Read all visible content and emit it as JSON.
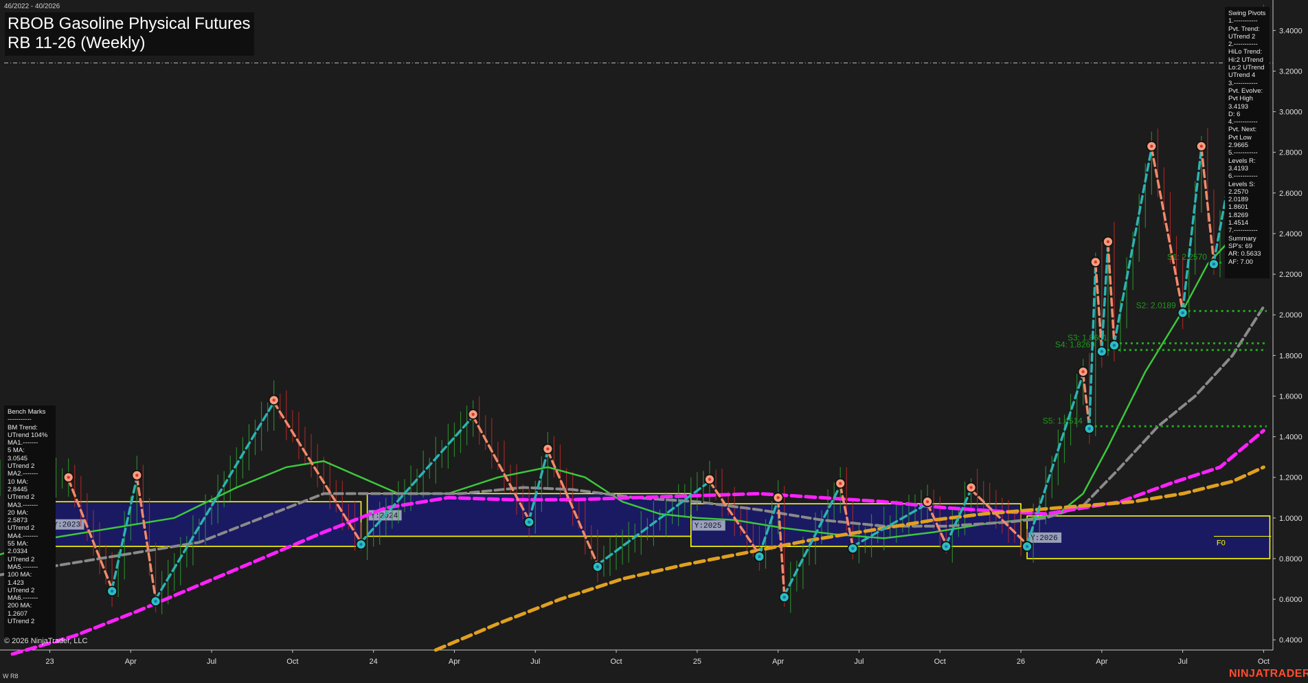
{
  "header": {
    "date_range": "46/2022 - 40/2026",
    "title_line1": "RBOB Gasoline Physical Futures",
    "title_line2": "RB 11-26 (Weekly)"
  },
  "footer": {
    "copyright": "© 2026 NinjaTrader, LLC",
    "period": "W R8",
    "brand": "NINJATRADER"
  },
  "swing_pivots_panel": [
    "Swing Pivots",
    "1.-----------",
    "Pvt. Trend:",
    "UTrend 2",
    "2.-----------",
    "HiLo Trend:",
    "Hi:2 UTrend",
    "Lo:2 UTrend",
    "UTrend 4",
    "3.-----------",
    "Pvt. Evolve:",
    "Pvt High",
    "3.4193",
    "D: 6",
    "4.-----------",
    "Pvt. Next:",
    "Pvt Low",
    "2.9665",
    "5.-----------",
    "Levels R:",
    "3.4193",
    "6.-----------",
    "Levels S:",
    "2.2570",
    "2.0189",
    "1.8601",
    "1.8269",
    "1.4514",
    "7.-----------",
    "Summary",
    "SP's: 69",
    "AR: 0.5633",
    "AF: 7.00"
  ],
  "bench_marks_panel": [
    "Bench Marks",
    "-----------",
    "BM Trend:",
    "UTrend 104%",
    "MA1.-------",
    "5 MA:",
    "3.0545",
    "UTrend 2",
    "MA2.-------",
    "10 MA:",
    "2.8445",
    "UTrend 2",
    "MA3.-------",
    "20 MA:",
    "2.5873",
    "UTrend 2",
    "MA4.-------",
    "55 MA:",
    "2.0334",
    "UTrend 2",
    "MA5.-------",
    "100 MA:",
    "1.423",
    "UTrend 2",
    "MA6.-------",
    "200 MA:",
    "1.2607",
    "UTrend 2"
  ],
  "colors": {
    "background": "#1c1c1c",
    "pivot_up_line": "#2bb3b3",
    "pivot_down_line": "#f08a6a",
    "ma_fast": "#3cc83c",
    "ma_55": "#8a8a8a",
    "ma_100": "#ff22ff",
    "ma_200": "#e0a020",
    "year_box": "#ffff00",
    "year_fill": "#1a1a6e",
    "support": "#1faa1f"
  },
  "chart_data": {
    "type": "line",
    "xlabel": "",
    "ylabel": "",
    "ylim": [
      0.35,
      3.55
    ],
    "y_ticks": [
      "3.4000",
      "3.2000",
      "3.0000",
      "2.8000",
      "2.6000",
      "2.4000",
      "2.2000",
      "2.0000",
      "1.8000",
      "1.6000",
      "1.4000",
      "1.2000",
      "1.0000",
      "0.8000",
      "0.6000",
      "0.4000"
    ],
    "x_ticks": [
      {
        "label": "23",
        "week": 0
      },
      {
        "label": "Apr",
        "week": 13
      },
      {
        "label": "Jul",
        "week": 26
      },
      {
        "label": "Oct",
        "week": 39
      },
      {
        "label": "24",
        "week": 52
      },
      {
        "label": "Apr",
        "week": 65
      },
      {
        "label": "Jul",
        "week": 78
      },
      {
        "label": "Oct",
        "week": 91
      },
      {
        "label": "25",
        "week": 104
      },
      {
        "label": "Apr",
        "week": 117
      },
      {
        "label": "Jul",
        "week": 130
      },
      {
        "label": "Oct",
        "week": 143
      },
      {
        "label": "26",
        "week": 156
      },
      {
        "label": "Apr",
        "week": 169
      },
      {
        "label": "Jul",
        "week": 182
      },
      {
        "label": "Oct",
        "week": 195
      }
    ],
    "x_range": [
      -8,
      196.5
    ],
    "current_price": 3.24,
    "pivots": [
      {
        "week": 3,
        "price": 1.19,
        "type": "high"
      },
      {
        "week": 10,
        "price": 0.65,
        "type": "low"
      },
      {
        "week": 14,
        "price": 1.2,
        "type": "high"
      },
      {
        "week": 17,
        "price": 0.6,
        "type": "low"
      },
      {
        "week": 36,
        "price": 1.57,
        "type": "high"
      },
      {
        "week": 50,
        "price": 0.88,
        "type": "low"
      },
      {
        "week": 68,
        "price": 1.5,
        "type": "high"
      },
      {
        "week": 77,
        "price": 0.99,
        "type": "low"
      },
      {
        "week": 80,
        "price": 1.33,
        "type": "high"
      },
      {
        "week": 88,
        "price": 0.77,
        "type": "low"
      },
      {
        "week": 106,
        "price": 1.18,
        "type": "high"
      },
      {
        "week": 114,
        "price": 0.82,
        "type": "low"
      },
      {
        "week": 117,
        "price": 1.09,
        "type": "high"
      },
      {
        "week": 118,
        "price": 0.62,
        "type": "low"
      },
      {
        "week": 127,
        "price": 1.16,
        "type": "high"
      },
      {
        "week": 129,
        "price": 0.86,
        "type": "low"
      },
      {
        "week": 141,
        "price": 1.07,
        "type": "high"
      },
      {
        "week": 144,
        "price": 0.87,
        "type": "low"
      },
      {
        "week": 148,
        "price": 1.14,
        "type": "high"
      },
      {
        "week": 157,
        "price": 0.87,
        "type": "low"
      },
      {
        "week": 166,
        "price": 1.71,
        "type": "high"
      },
      {
        "week": 167,
        "price": 1.45,
        "type": "low"
      },
      {
        "week": 168,
        "price": 2.25,
        "type": "high"
      },
      {
        "week": 169,
        "price": 1.83,
        "type": "low"
      },
      {
        "week": 170,
        "price": 2.35,
        "type": "high"
      },
      {
        "week": 171,
        "price": 1.86,
        "type": "low"
      },
      {
        "week": 177,
        "price": 2.82,
        "type": "high"
      },
      {
        "week": 182,
        "price": 2.02,
        "type": "low"
      },
      {
        "week": 185,
        "price": 2.82,
        "type": "high"
      },
      {
        "week": 187,
        "price": 2.26,
        "type": "low"
      },
      {
        "week": 194,
        "price": 3.42,
        "type": "high"
      }
    ],
    "moving_averages": [
      {
        "name": "MA fast",
        "points": [
          [
            -8,
            0.82
          ],
          [
            0,
            0.9
          ],
          [
            10,
            0.95
          ],
          [
            20,
            1.0
          ],
          [
            30,
            1.15
          ],
          [
            38,
            1.25
          ],
          [
            44,
            1.28
          ],
          [
            50,
            1.2
          ],
          [
            56,
            1.12
          ],
          [
            64,
            1.12
          ],
          [
            72,
            1.2
          ],
          [
            80,
            1.25
          ],
          [
            86,
            1.2
          ],
          [
            92,
            1.08
          ],
          [
            98,
            1.02
          ],
          [
            104,
            1.0
          ],
          [
            110,
            0.99
          ],
          [
            118,
            0.95
          ],
          [
            126,
            0.92
          ],
          [
            134,
            0.9
          ],
          [
            142,
            0.93
          ],
          [
            150,
            0.97
          ],
          [
            156,
            0.99
          ],
          [
            162,
            1.02
          ],
          [
            166,
            1.12
          ],
          [
            170,
            1.35
          ],
          [
            176,
            1.72
          ],
          [
            182,
            2.02
          ],
          [
            186,
            2.25
          ],
          [
            190,
            2.38
          ],
          [
            193,
            2.5
          ],
          [
            195,
            2.58
          ]
        ]
      },
      {
        "name": "MA 55",
        "points": [
          [
            -8,
            0.72
          ],
          [
            4,
            0.78
          ],
          [
            14,
            0.83
          ],
          [
            24,
            0.88
          ],
          [
            34,
            1.0
          ],
          [
            44,
            1.12
          ],
          [
            54,
            1.12
          ],
          [
            66,
            1.12
          ],
          [
            76,
            1.15
          ],
          [
            84,
            1.14
          ],
          [
            94,
            1.1
          ],
          [
            104,
            1.08
          ],
          [
            114,
            1.04
          ],
          [
            124,
            0.99
          ],
          [
            134,
            0.96
          ],
          [
            144,
            0.96
          ],
          [
            154,
            0.98
          ],
          [
            160,
            1.0
          ],
          [
            166,
            1.06
          ],
          [
            172,
            1.25
          ],
          [
            178,
            1.45
          ],
          [
            184,
            1.6
          ],
          [
            190,
            1.8
          ],
          [
            195,
            2.04
          ]
        ]
      },
      {
        "name": "MA 100",
        "points": [
          [
            -6,
            0.33
          ],
          [
            4,
            0.42
          ],
          [
            14,
            0.54
          ],
          [
            24,
            0.67
          ],
          [
            34,
            0.8
          ],
          [
            44,
            0.93
          ],
          [
            54,
            1.05
          ],
          [
            64,
            1.1
          ],
          [
            74,
            1.09
          ],
          [
            84,
            1.09
          ],
          [
            94,
            1.1
          ],
          [
            104,
            1.11
          ],
          [
            114,
            1.12
          ],
          [
            124,
            1.1
          ],
          [
            134,
            1.08
          ],
          [
            144,
            1.05
          ],
          [
            154,
            1.03
          ],
          [
            160,
            1.02
          ],
          [
            166,
            1.05
          ],
          [
            172,
            1.08
          ],
          [
            180,
            1.17
          ],
          [
            188,
            1.25
          ],
          [
            195,
            1.43
          ]
        ]
      },
      {
        "name": "MA 200",
        "points": [
          [
            62,
            0.35
          ],
          [
            72,
            0.48
          ],
          [
            82,
            0.6
          ],
          [
            92,
            0.7
          ],
          [
            102,
            0.77
          ],
          [
            112,
            0.83
          ],
          [
            122,
            0.89
          ],
          [
            132,
            0.94
          ],
          [
            142,
            0.99
          ],
          [
            150,
            1.02
          ],
          [
            158,
            1.04
          ],
          [
            166,
            1.06
          ],
          [
            174,
            1.08
          ],
          [
            182,
            1.12
          ],
          [
            190,
            1.18
          ],
          [
            195,
            1.25
          ]
        ]
      }
    ],
    "support_levels": [
      {
        "label": "S1: 2.2570",
        "value": 2.257,
        "from_week": 187
      },
      {
        "label": "S2: 2.0189",
        "value": 2.0189,
        "from_week": 182
      },
      {
        "label": "S3: 1.8601",
        "value": 1.8601,
        "from_week": 171
      },
      {
        "label": "S4: 1.8269",
        "value": 1.8269,
        "from_week": 169
      },
      {
        "label": "S5: 1.4514",
        "value": 1.4514,
        "from_week": 167
      }
    ],
    "year_boxes": [
      {
        "label": "Y:2023",
        "from_week": 0,
        "to_week": 50,
        "low": 0.86,
        "high": 1.08
      },
      {
        "label": "Y:2024",
        "from_week": 51,
        "to_week": 103,
        "low": 0.91,
        "high": 1.12
      },
      {
        "label": "Y:2025",
        "from_week": 103,
        "to_week": 156,
        "low": 0.86,
        "high": 1.07
      },
      {
        "label": "Y:2026",
        "from_week": 157,
        "to_week": 196,
        "low": 0.8,
        "high": 1.01
      }
    ],
    "fib_label": "F0",
    "fib_value": 0.91
  }
}
